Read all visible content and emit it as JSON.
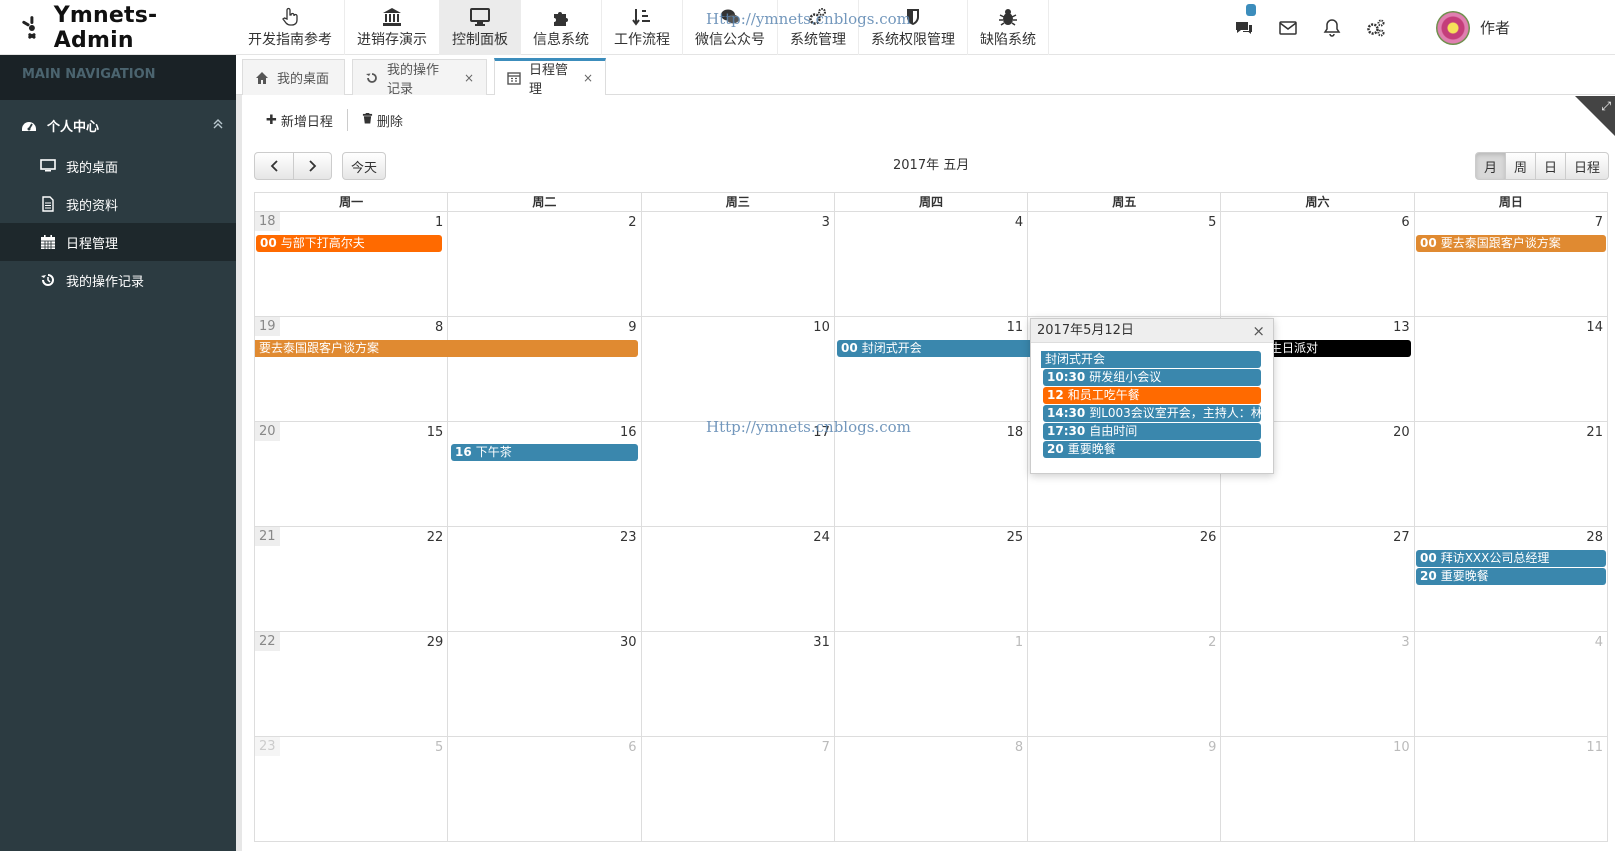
{
  "app": {
    "title": "Ymnets-Admin",
    "user": "作者",
    "watermark": "Http://ymnets.cnblogs.com",
    "message_badge": ""
  },
  "topnav": [
    {
      "label": "开发指南参考",
      "icon": "hand-pointer-icon"
    },
    {
      "label": "进销存演示",
      "icon": "bank-icon"
    },
    {
      "label": "控制面板",
      "icon": "monitor-icon",
      "active": true
    },
    {
      "label": "信息系统",
      "icon": "puzzle-icon"
    },
    {
      "label": "工作流程",
      "icon": "sort-icon"
    },
    {
      "label": "微信公众号",
      "icon": "wechat-icon"
    },
    {
      "label": "系统管理",
      "icon": "gears-icon"
    },
    {
      "label": "系统权限管理",
      "icon": "shield-icon"
    },
    {
      "label": "缺陷系统",
      "icon": "bug-icon"
    }
  ],
  "sidebar": {
    "header": "MAIN NAVIGATION",
    "group": "个人中心",
    "items": [
      {
        "label": "我的桌面",
        "icon": "desktop-icon"
      },
      {
        "label": "我的资料",
        "icon": "file-icon"
      },
      {
        "label": "日程管理",
        "icon": "calendar-icon",
        "active": true
      },
      {
        "label": "我的操作记录",
        "icon": "history-icon"
      }
    ]
  },
  "tabs": [
    {
      "label": "我的桌面",
      "close": ""
    },
    {
      "label": "我的操作记录",
      "close": "×"
    },
    {
      "label": "日程管理",
      "close": "×"
    }
  ],
  "toolbar": {
    "add": "新增日程",
    "delete": "删除"
  },
  "calendar": {
    "title": "2017年 五月",
    "today": "今天",
    "views": [
      "月",
      "周",
      "日",
      "日程"
    ],
    "dow": [
      "周一",
      "周二",
      "周三",
      "周四",
      "周五",
      "周六",
      "周日"
    ],
    "weeks": [
      {
        "wk": "18",
        "days": [
          "1",
          "2",
          "3",
          "4",
          "5",
          "6",
          "7"
        ],
        "other": []
      },
      {
        "wk": "19",
        "days": [
          "8",
          "9",
          "10",
          "11",
          "12",
          "13",
          "14"
        ],
        "other": []
      },
      {
        "wk": "20",
        "days": [
          "15",
          "16",
          "17",
          "18",
          "19",
          "20",
          "21"
        ],
        "other": []
      },
      {
        "wk": "21",
        "days": [
          "22",
          "23",
          "24",
          "25",
          "26",
          "27",
          "28"
        ],
        "other": []
      },
      {
        "wk": "22",
        "days": [
          "29",
          "30",
          "31",
          "1",
          "2",
          "3",
          "4"
        ],
        "other": [
          3,
          4,
          5,
          6
        ]
      },
      {
        "wk": "23",
        "days": [
          "5",
          "6",
          "7",
          "8",
          "9",
          "10",
          "11"
        ],
        "other": [
          0,
          1,
          2,
          3,
          4,
          5,
          6
        ]
      }
    ],
    "events": [
      {
        "t": "00",
        "title": "与部下打高尔夫",
        "color": "orange"
      },
      {
        "t": "00",
        "title": "要去泰国跟客户谈方案",
        "color": "amber"
      },
      {
        "t": "",
        "title": "要去泰国跟客户谈方案",
        "color": "amber"
      },
      {
        "t": "00",
        "title": "封闭式开会",
        "color": "blue"
      },
      {
        "t": "",
        "title": "生日派对",
        "color": "black"
      },
      {
        "t": "16",
        "title": "下午茶",
        "color": "blue"
      },
      {
        "t": "00",
        "title": "拜访XXX公司总经理",
        "color": "blue"
      },
      {
        "t": "20",
        "title": "重要晚餐",
        "color": "blue"
      }
    ]
  },
  "popover": {
    "title": "2017年5月12日",
    "close": "×",
    "events": [
      {
        "t": "",
        "title": "封闭式开会",
        "color": "blue"
      },
      {
        "t": "10:30",
        "title": "研发组小会议",
        "color": "blue"
      },
      {
        "t": "12",
        "title": "和员工吃午餐",
        "color": "orange"
      },
      {
        "t": "14:30",
        "title": "到L003会议室开会，主持人：林",
        "color": "blue"
      },
      {
        "t": "17:30",
        "title": "自由时间",
        "color": "blue"
      },
      {
        "t": "20",
        "title": "重要晚餐",
        "color": "blue"
      }
    ]
  }
}
